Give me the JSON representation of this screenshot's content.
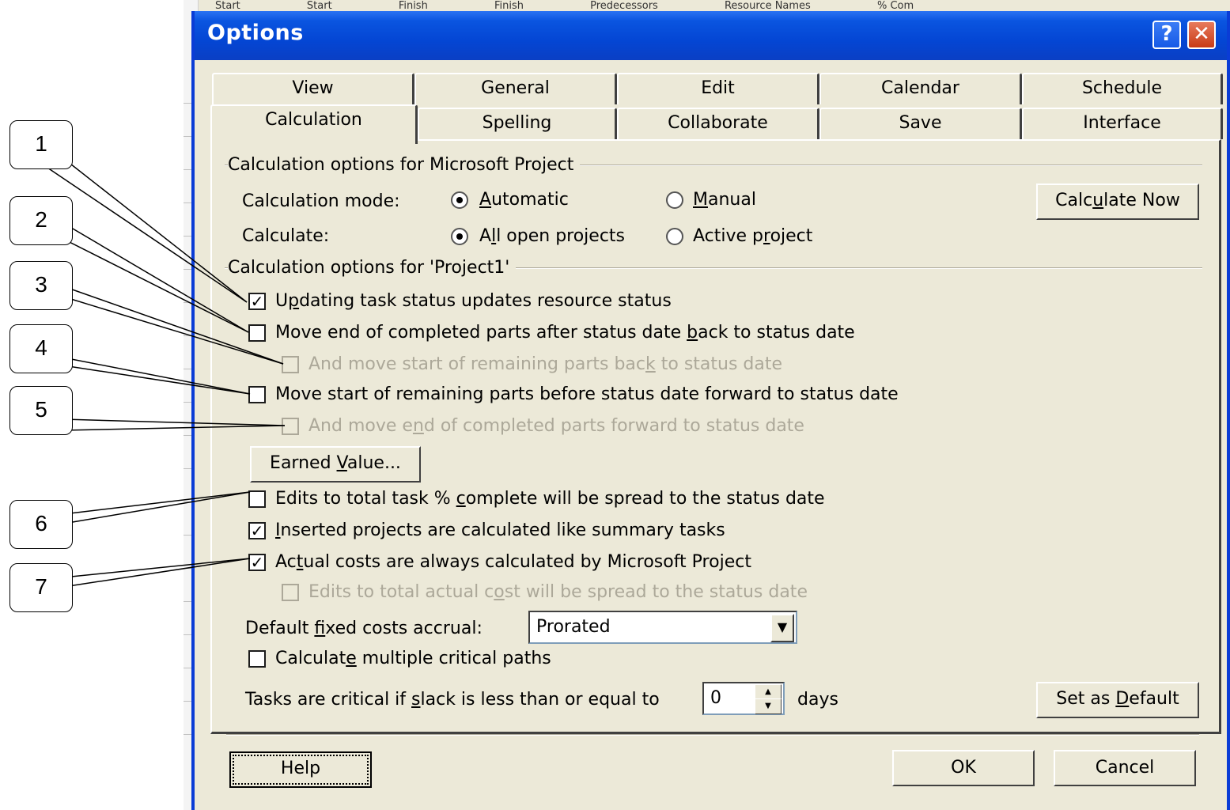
{
  "background": {
    "header_cells": [
      "Start",
      "Start",
      "Finish",
      "Finish",
      "Predecessors",
      "Resource Names",
      "% Com"
    ]
  },
  "dialog": {
    "title": "Options",
    "help_icon": "?",
    "close_icon": "✕"
  },
  "tabs": {
    "row1": [
      "View",
      "General",
      "Edit",
      "Calendar",
      "Schedule"
    ],
    "row2": [
      "Calculation",
      "Spelling",
      "Collaborate",
      "Save",
      "Interface"
    ],
    "active": "Calculation"
  },
  "group1": {
    "label": "Calculation options for Microsoft Project",
    "calc_mode_label": "Calculation mode:",
    "calc_mode_options": [
      "Automatic",
      "Manual"
    ],
    "calc_mode_selected": "Automatic",
    "calculate_label": "Calculate:",
    "calculate_options": [
      "All open projects",
      "Active project"
    ],
    "calculate_selected": "All open projects",
    "calculate_now": "Calculate Now"
  },
  "group2": {
    "label": "Calculation options for 'Project1'",
    "options": [
      {
        "label": "Updating task status updates resource status",
        "checked": true,
        "enabled": true
      },
      {
        "label": "Move end of completed parts after status date back to status date",
        "checked": false,
        "enabled": true
      },
      {
        "label": "And move start of remaining parts back to status date",
        "checked": false,
        "enabled": false
      },
      {
        "label": "Move start of remaining parts before status date forward to status date",
        "checked": false,
        "enabled": true
      },
      {
        "label": "And move end of completed parts forward to status date",
        "checked": false,
        "enabled": false
      }
    ],
    "earned_value": "Earned Value...",
    "options2": [
      {
        "label": "Edits to total task % complete will be spread to the status date",
        "checked": false,
        "enabled": true
      },
      {
        "label": "Inserted projects are calculated like summary tasks",
        "checked": true,
        "enabled": true
      },
      {
        "label": "Actual costs are always calculated by Microsoft Project",
        "checked": true,
        "enabled": true
      },
      {
        "label": "Edits to total actual cost will be spread to the status date",
        "checked": false,
        "enabled": false
      }
    ],
    "fixed_costs_label": "Default fixed costs accrual:",
    "fixed_costs_value": "Prorated",
    "multiple_paths": {
      "label": "Calculate multiple critical paths",
      "checked": false
    },
    "slack_label": "Tasks are critical if slack is less than or equal to",
    "slack_value": "0",
    "slack_unit": "days",
    "set_default": "Set as Default"
  },
  "footer": {
    "help": "Help",
    "ok": "OK",
    "cancel": "Cancel"
  },
  "callouts": [
    "1",
    "2",
    "3",
    "4",
    "5",
    "6",
    "7"
  ]
}
